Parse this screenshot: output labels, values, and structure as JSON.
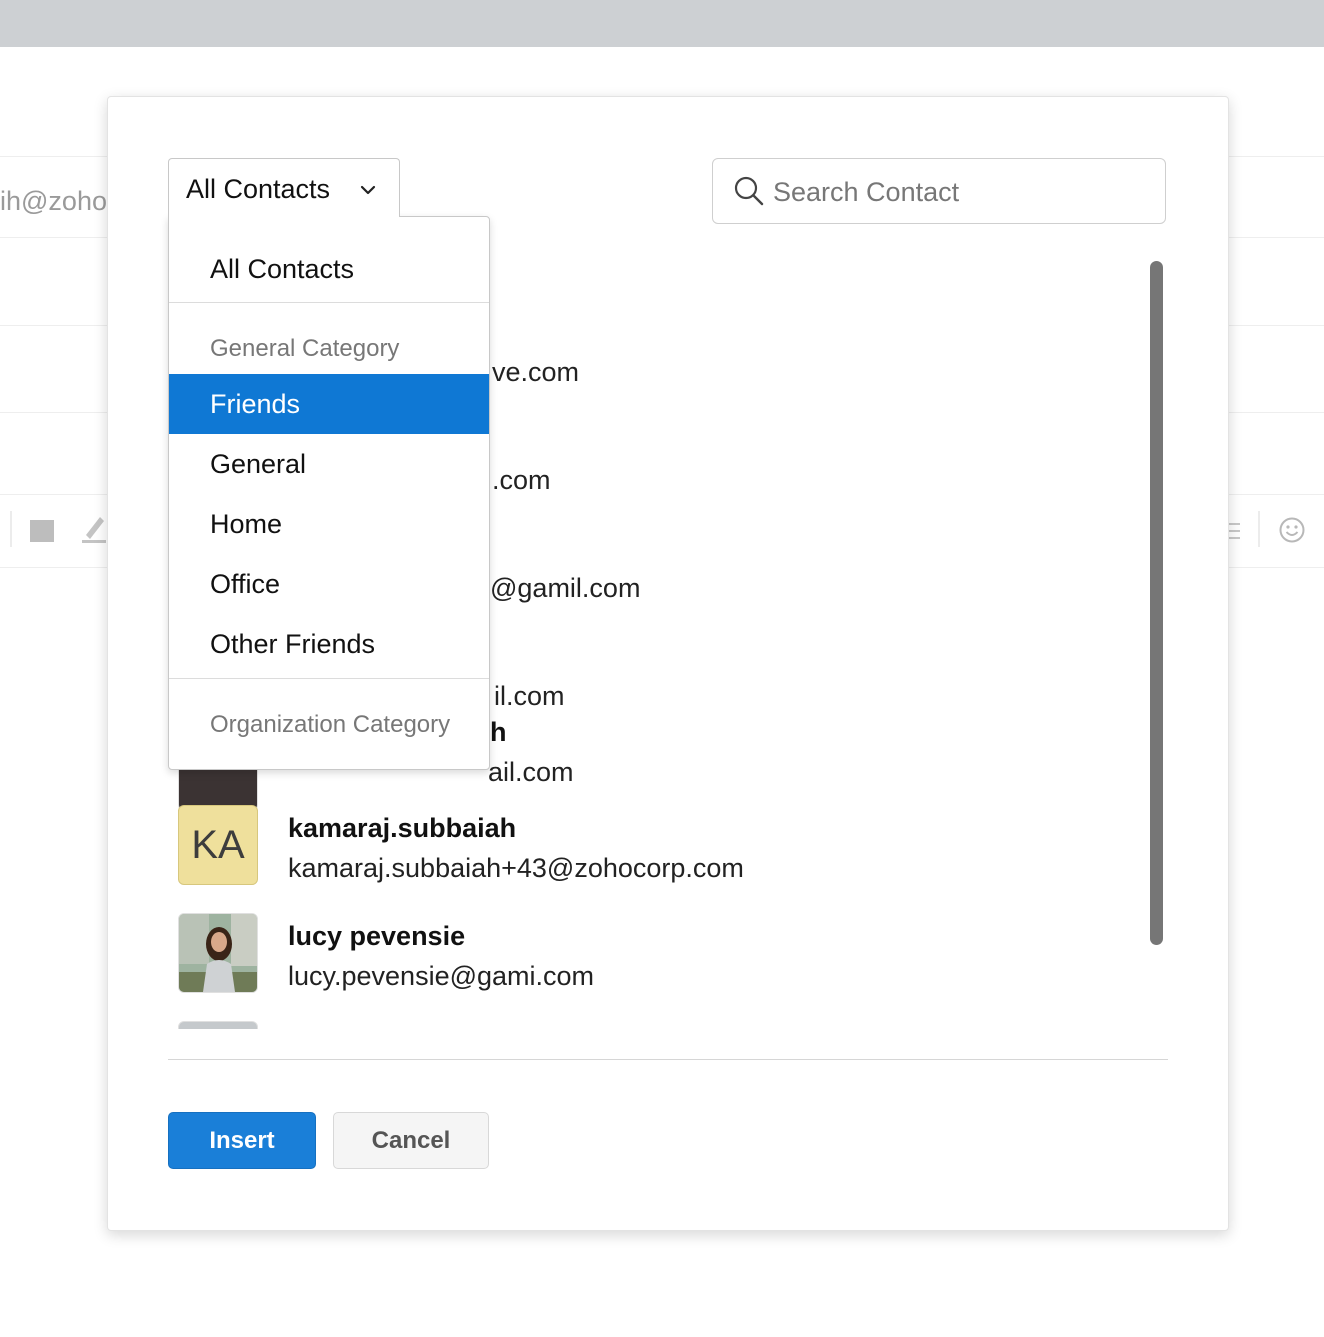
{
  "background": {
    "partial_email": "ih@zoho"
  },
  "dropdown": {
    "selected_label": "All Contacts",
    "options": {
      "all_contacts": "All Contacts",
      "general_category": "General Category",
      "friends": "Friends",
      "general": "General",
      "home": "Home",
      "office": "Office",
      "other_friends": "Other Friends",
      "organization_category": "Organization Category"
    },
    "highlighted": "Friends"
  },
  "search": {
    "placeholder": "Search Contact",
    "value": ""
  },
  "contacts": [
    {
      "name": "",
      "email": "ve.com",
      "visible_part": "partial"
    },
    {
      "name": "",
      "email": ".com",
      "visible_part": "partial"
    },
    {
      "name": "",
      "email": "@gamil.com",
      "visible_part": "partial"
    },
    {
      "name": "",
      "email": "il.com",
      "visible_part": "partial"
    },
    {
      "name": "h",
      "email": "ail.com",
      "visible_part": "partial"
    },
    {
      "name": "kamaraj.subbaiah",
      "email": "kamaraj.subbaiah+43@zohocorp.com",
      "avatar_initials": "KA"
    },
    {
      "name": "lucy pevensie",
      "email": "lucy.pevensie@gami.com"
    }
  ],
  "buttons": {
    "insert": "Insert",
    "cancel": "Cancel"
  },
  "colors": {
    "primary": "#1a7fd8",
    "highlight": "#0f78d4",
    "initials_avatar": "#efe09c"
  }
}
